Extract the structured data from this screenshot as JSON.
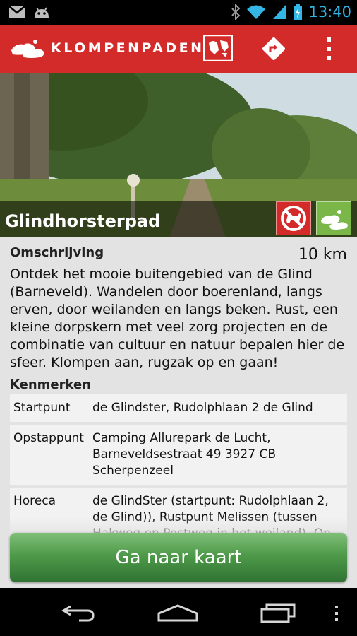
{
  "status_bar": {
    "time": "13:40",
    "icons": [
      "gmail-icon",
      "android-icon",
      "bluetooth-icon",
      "wifi-icon",
      "signal-icon",
      "battery-charging-icon"
    ]
  },
  "action_bar": {
    "brand": "KLOMPENPADEN",
    "icons": [
      "klompen-logo-icon",
      "map-icon",
      "route-icon",
      "overflow-menu-icon"
    ],
    "color": "#d32a2a"
  },
  "route": {
    "title": "Glindhorsterpad",
    "badges": [
      "no-dogs-icon",
      "klompen-shoe-icon"
    ]
  },
  "description": {
    "heading": "Omschrijving",
    "distance": "10 km",
    "text": "Ontdek het mooie buitengebied van de Glind (Barneveld). Wandelen door boerenland, langs erven, door weilanden en langs beken. Rust, een kleine dorpskern met veel zorg projecten en de combinatie van cultuur en natuur bepalen hier de sfeer. Klompen aan, rugzak op en gaan!"
  },
  "features": {
    "heading": "Kenmerken",
    "rows": [
      {
        "key": "Startpunt",
        "value": "de Glindster, Rudolphlaan 2 de Glind"
      },
      {
        "key": "Opstappunt",
        "value": "Camping Allurepark de Lucht, Barneveldsestraat 49 3927 CB Scherpenzeel"
      },
      {
        "key": "Horeca",
        "value": "de GlindSter (startpunt: Rudolphlaan 2, de Glind)), Rustpunt Melissen (tussen Hakweg en Postweg in het weiland). Op"
      }
    ]
  },
  "button": {
    "label": "Ga naar kaart",
    "color": "#4f9a4a"
  },
  "nav_bar": {
    "icons": [
      "back-icon",
      "home-icon",
      "recent-apps-icon",
      "menu-icon"
    ]
  }
}
